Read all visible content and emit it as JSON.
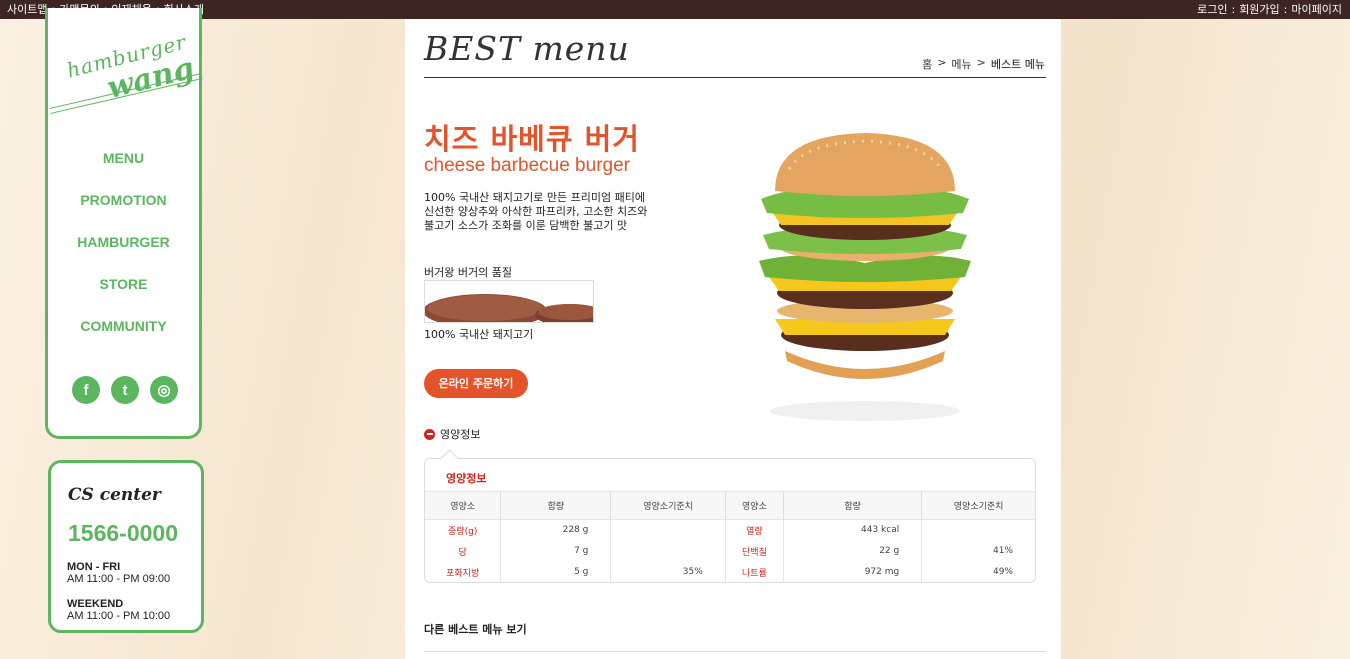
{
  "topbar": {
    "left": [
      "사이트맵",
      "가맹문의",
      "인재채용",
      "회사소개"
    ],
    "right": [
      "로그인",
      "회원가입",
      "마이페이지"
    ],
    "sep": ":"
  },
  "logo": {
    "line1": "hamburger",
    "line2": "wang"
  },
  "nav": [
    "MENU",
    "PROMOTION",
    "HAMBURGER",
    "STORE",
    "COMMUNITY"
  ],
  "social": [
    {
      "icon": "facebook-icon",
      "glyph": "f"
    },
    {
      "icon": "twitter-icon",
      "glyph": "t"
    },
    {
      "icon": "instagram-icon",
      "glyph": "◎"
    }
  ],
  "cs": {
    "title": "CS center",
    "phone": "1566-0000",
    "weekday_label": "MON - FRI",
    "weekday_hours": "AM 11:00 - PM 09:00",
    "weekend_label": "WEEKEND",
    "weekend_hours": "AM 11:00 - PM 10:00"
  },
  "page": {
    "title": "BEST menu",
    "breadcrumb": [
      "홈",
      ">",
      "메뉴",
      ">",
      "베스트 메뉴"
    ]
  },
  "product": {
    "name_ko": "치즈 바베큐 버거",
    "name_en": "cheese barbecue burger",
    "desc": [
      "100% 국내산 돼지고기로 만든 프리미엄 패티에",
      "신선한 양상추와 아삭한 파프리카, 고소한 치즈와",
      "불고기 소스가 조화를 이룬 담백한 불고기 맛"
    ],
    "quality_label": "버거왕 버거의 품질",
    "patty_label": "100% 국내산 돼지고기",
    "order_button": "온라인 주문하기"
  },
  "nutrition": {
    "toggle": "영양정보",
    "heading": "영양정보",
    "headers": [
      "영양소",
      "함량",
      "영양소기준치",
      "영양소",
      "함량",
      "영양소기준치"
    ],
    "rows": [
      [
        "중량(g)",
        "228 g",
        "",
        "열량",
        "443 kcal",
        ""
      ],
      [
        "당",
        "7 g",
        "",
        "단백질",
        "22 g",
        "41%"
      ],
      [
        "포화지방",
        "5 g",
        "35%",
        "나트륨",
        "972 mg",
        "49%"
      ]
    ]
  },
  "other": "다른 베스트 메뉴 보기",
  "colors": {
    "brand_green": "#5bb65f",
    "accent": "#e4542a",
    "topbar": "#3d2523",
    "nutrient": "#c8281e"
  }
}
